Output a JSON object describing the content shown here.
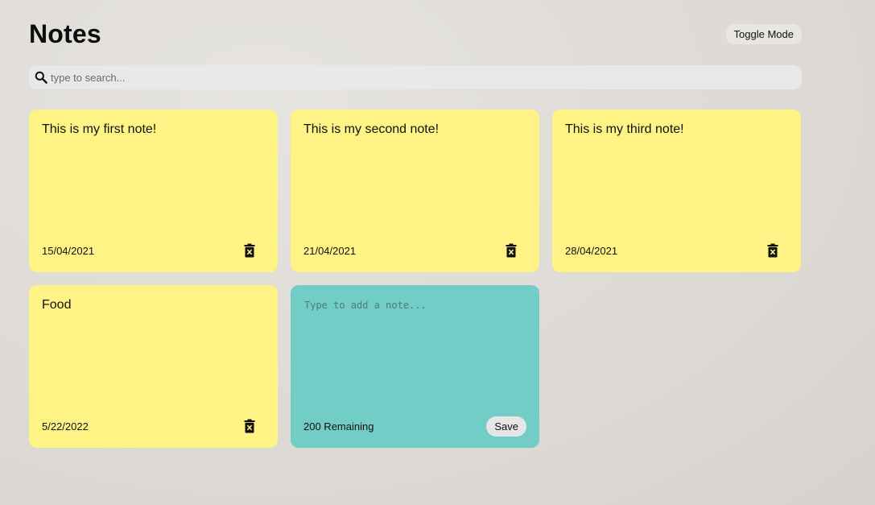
{
  "header": {
    "title": "Notes",
    "toggle_label": "Toggle Mode"
  },
  "search": {
    "placeholder": "type to search...",
    "value": "",
    "icon": "search-icon"
  },
  "notes": [
    {
      "text": "This is my first note!",
      "date": "15/04/2021",
      "color": "#fef384",
      "delete_icon": "trash-icon"
    },
    {
      "text": "This is my second note!",
      "date": "21/04/2021",
      "color": "#fef384",
      "delete_icon": "trash-icon"
    },
    {
      "text": "This is my third note!",
      "date": "28/04/2021",
      "color": "#fef384",
      "delete_icon": "trash-icon"
    },
    {
      "text": "Food",
      "date": "5/22/2022",
      "color": "#fef384",
      "delete_icon": "trash-icon"
    }
  ],
  "new_note": {
    "placeholder": "Type to add a note...",
    "value": "",
    "remaining_text": "200 Remaining",
    "save_label": "Save",
    "color": "#71cdc5"
  }
}
